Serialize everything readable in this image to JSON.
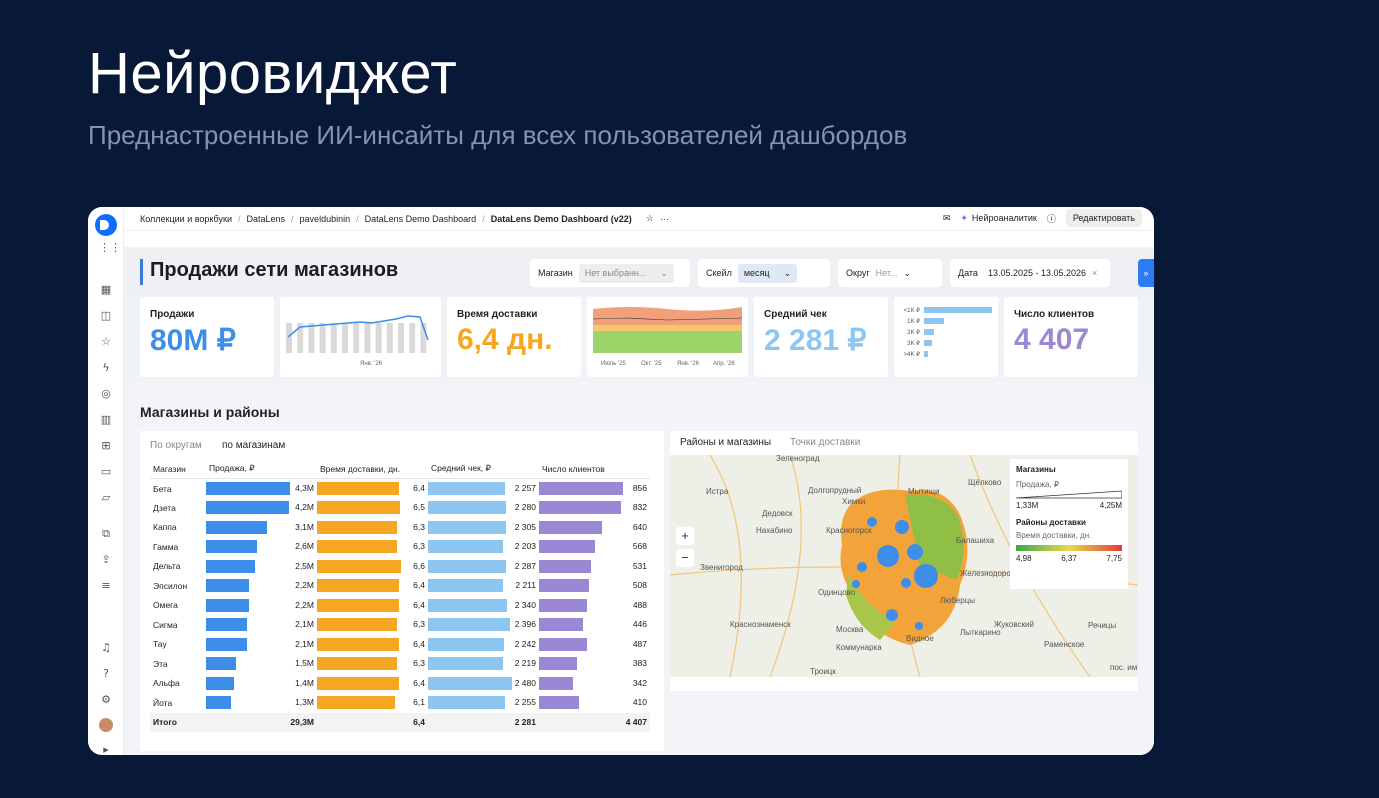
{
  "slide": {
    "title": "Нейровиджет",
    "subtitle": "Преднастроенные ИИ-инсайты для всех пользователей дашбордов"
  },
  "breadcrumb": [
    "Коллекции и воркбуки",
    "DataLens",
    "paveldubinin",
    "DataLens Demo Dashboard",
    "DataLens Demo Dashboard (v22)"
  ],
  "topbar": {
    "ai_label": "Нейроаналитик",
    "edit_label": "Редактировать"
  },
  "dashboard": {
    "title": "Продажи сети магазинов"
  },
  "filters": {
    "store_label": "Магазин",
    "store_value": "Нет выбранн...",
    "scale_label": "Скейл",
    "scale_value": "месяц",
    "district_label": "Округ",
    "district_value": "Нет...",
    "date_label": "Дата",
    "date_value": "13.05.2025 - 13.05.2026"
  },
  "kpis": {
    "sales_label": "Продажи",
    "sales_value": "80M ₽",
    "delivery_label": "Время доставки",
    "delivery_value": "6,4 дн.",
    "check_label": "Средний чек",
    "check_value": "2 281 ₽",
    "clients_label": "Число клиентов",
    "clients_value": "4 407"
  },
  "colors": {
    "sales": "#3d8ee8",
    "delivery": "#f5a623",
    "check": "#8ec6f2",
    "clients": "#9a88d4",
    "accent": "#2e7bf6"
  },
  "sales_spark_label": "Янв. '26",
  "area_ticks": [
    "Июль '25",
    "Окт. '25",
    "Янв. '26",
    "Апр. '26"
  ],
  "check_hist": {
    "labels": [
      "<1K ₽",
      "1K ₽",
      "2K ₽",
      "3K ₽",
      ">4K ₽"
    ],
    "values": [
      68,
      20,
      10,
      8,
      4
    ]
  },
  "section": {
    "title": "Магазины и районы"
  },
  "table_tabs": [
    "По округам",
    "по магазинам"
  ],
  "table": {
    "headers": [
      "Магазин",
      "Продажа, ₽",
      "Время доставки, дн.",
      "Средний чек, ₽",
      "Число клиентов"
    ],
    "rows": [
      [
        "Бета",
        "4,3M",
        "6,4",
        "2 257",
        "856"
      ],
      [
        "Дзета",
        "4,2M",
        "6,5",
        "2 280",
        "832"
      ],
      [
        "Каппа",
        "3,1M",
        "6,3",
        "2 305",
        "640"
      ],
      [
        "Гамма",
        "2,6M",
        "6,3",
        "2 203",
        "568"
      ],
      [
        "Дельта",
        "2,5M",
        "6,6",
        "2 287",
        "531"
      ],
      [
        "Эпсилон",
        "2,2M",
        "6,4",
        "2 211",
        "508"
      ],
      [
        "Омега",
        "2,2M",
        "6,4",
        "2 340",
        "488"
      ],
      [
        "Сигма",
        "2,1M",
        "6,3",
        "2 396",
        "446"
      ],
      [
        "Тау",
        "2,1M",
        "6,4",
        "2 242",
        "487"
      ],
      [
        "Эта",
        "1,5M",
        "6,3",
        "2 219",
        "383"
      ],
      [
        "Альфа",
        "1,4M",
        "6,4",
        "2 480",
        "342"
      ],
      [
        "Йота",
        "1,3M",
        "6,1",
        "2 255",
        "410"
      ]
    ],
    "total": [
      "Итого",
      "29,3M",
      "6,4",
      "2 281",
      "4 407"
    ],
    "fracs": [
      [
        1,
        0.97,
        0.91,
        1
      ],
      [
        0.98,
        0.98,
        0.92,
        0.97
      ],
      [
        0.72,
        0.95,
        0.93,
        0.75
      ],
      [
        0.6,
        0.95,
        0.89,
        0.66
      ],
      [
        0.58,
        1,
        0.92,
        0.62
      ],
      [
        0.51,
        0.97,
        0.89,
        0.59
      ],
      [
        0.51,
        0.97,
        0.94,
        0.57
      ],
      [
        0.49,
        0.95,
        0.97,
        0.52
      ],
      [
        0.49,
        0.97,
        0.9,
        0.57
      ],
      [
        0.35,
        0.95,
        0.89,
        0.45
      ],
      [
        0.33,
        0.97,
        1,
        0.4
      ],
      [
        0.3,
        0.92,
        0.91,
        0.48
      ]
    ]
  },
  "map_tabs": [
    "Районы и магазины",
    "Точки доставки"
  ],
  "map_labels": [
    "Зеленоград",
    "Истра",
    "Химки",
    "Мытищи",
    "Щёлково",
    "Долгопрудный",
    "Дедовск",
    "Нахабино",
    "Красногорск",
    "Звенигород",
    "Балашиха",
    "Железнодорожный",
    "Одинцово",
    "Краснознаменск",
    "Москва",
    "Люберцы",
    "Лыткарино",
    "Жуковский",
    "Видное",
    "Коммунарка",
    "Троицк",
    "Раменское",
    "Речицы",
    "пос. им."
  ],
  "legend": {
    "title": "Магазины",
    "metric": "Продажа, ₽",
    "min": "1,33M",
    "max": "4,25M",
    "title2": "Районы доставки",
    "metric2": "Время доставки, дн.",
    "v1": "4,98",
    "v2": "6,37",
    "v3": "7,75"
  }
}
